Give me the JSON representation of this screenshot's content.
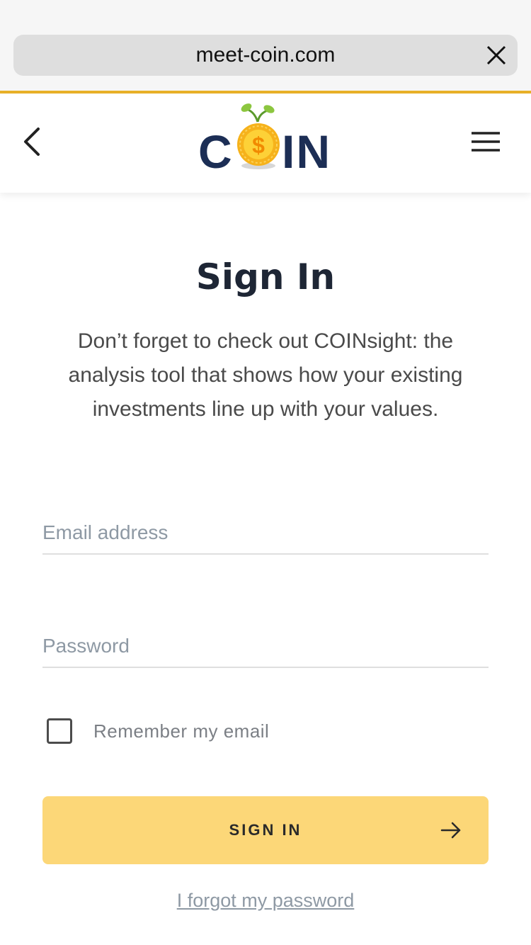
{
  "browser": {
    "url": "meet-coin.com",
    "close_icon": "close-icon",
    "accent_color": "#e9b128"
  },
  "header": {
    "back_icon": "chevron-left-icon",
    "menu_icon": "hamburger-menu-icon",
    "logo": {
      "left": "C",
      "right": "IN",
      "coin_symbol": "$"
    }
  },
  "main": {
    "title": "Sign In",
    "subtitle": "Don’t forget to check out COINsight: the analysis tool that shows how your existing investments line up with your values."
  },
  "form": {
    "email_placeholder": "Email address",
    "password_placeholder": "Password",
    "remember_label": "Remember my email",
    "remember_checked": false,
    "submit_label": "SIGN IN",
    "submit_icon": "arrow-right-icon",
    "submit_color": "#fcd778",
    "forgot_link": "I forgot my password"
  }
}
